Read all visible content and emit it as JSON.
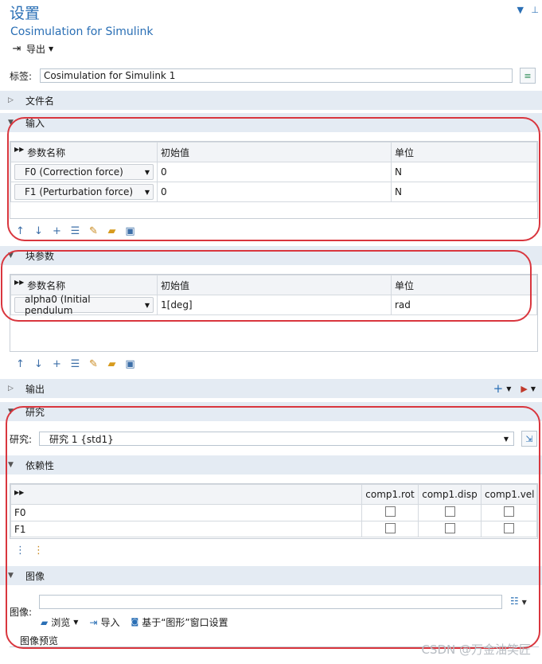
{
  "header": {
    "title": "设置",
    "subtitle": "Cosimulation for Simulink",
    "export_label": "导出",
    "pin_icon": "pin-icon",
    "menu_icon": "chevron-down-icon"
  },
  "label_field": {
    "label": "标签:",
    "value": "Cosimulation for Simulink 1"
  },
  "sections": {
    "filename": "文件名",
    "inputs": "输入",
    "block_params": "块参数",
    "outputs": "输出",
    "study": "研究",
    "dependency": "依赖性",
    "image": "图像"
  },
  "inputs_table": {
    "headers": [
      "参数名称",
      "初始值",
      "单位"
    ],
    "rows": [
      {
        "name": "F0 (Correction force)",
        "initial": "0",
        "unit": "N"
      },
      {
        "name": "F1 (Perturbation force)",
        "initial": "0",
        "unit": "N"
      }
    ]
  },
  "block_table": {
    "headers": [
      "参数名称",
      "初始值",
      "单位"
    ],
    "rows": [
      {
        "name": "alpha0 (Initial pendulum",
        "initial": "1[deg]",
        "unit": "rad"
      }
    ]
  },
  "study_field": {
    "label": "研究:",
    "value": "研究 1 {std1}"
  },
  "dependency_table": {
    "headers": [
      "comp1.rot",
      "comp1.disp",
      "comp1.vel"
    ],
    "rows": [
      {
        "name": "F0",
        "checks": [
          false,
          false,
          false
        ]
      },
      {
        "name": "F1",
        "checks": [
          false,
          false,
          false
        ]
      }
    ]
  },
  "image_section": {
    "label": "图像:",
    "browse": "浏览",
    "import": "导入",
    "from_graphics": "基于“图形”窗口设置",
    "preview": "图像预览"
  },
  "watermark": "CSDN @万金油笑匠",
  "colors": {
    "accent": "#2a6fb5",
    "section_bg": "#e4ebf3",
    "annotation_ring": "#d9363e"
  }
}
